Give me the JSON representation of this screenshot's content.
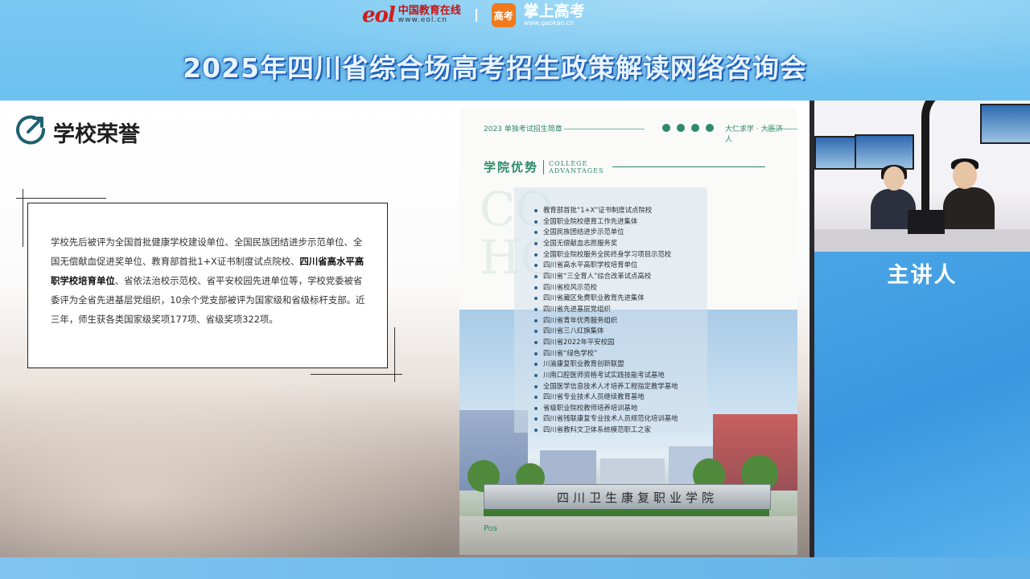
{
  "header": {
    "eol_brand": "eol",
    "eol_name": "中国教育在线",
    "eol_url": "www.eol.cn",
    "gaokao_badge": "高考",
    "gaokao_name": "掌上高考",
    "gaokao_url": "www.gaokao.cn",
    "title": "2025年四川省综合场高考招生政策解读网络咨询会"
  },
  "slide": {
    "section_title": "学校荣誉",
    "section_icon": "arrow-up-right-circle-icon",
    "paragraph": {
      "part1": "学校先后被评为全国首批健康学校建设单位、全国民族团结进步示范单位、全国无偿献血促进奖单位、教育部首批1+X证书制度试点院校、",
      "bold": "四川省高水平高职学校培育单位",
      "part2": "、省依法治校示范校、省平安校园先进单位等，学校党委被省委评为全省先进基层党组织，10余个党支部被评为国家级和省级标杆支部。近三年，师生获各类国家级奖项177项、省级奖项322项。"
    }
  },
  "brochure": {
    "year_label": "2023 单独考试招生简章",
    "motto": "大仁求学 · 大医济人",
    "section_cn": "学院优势",
    "section_en_1": "COLLEGE",
    "section_en_2": "ADVANTAGES",
    "watermark_1": "CO",
    "watermark_2": "HO",
    "gate_sign": "四川卫生康复职业学院",
    "footer_mark": "Pos",
    "honors": [
      "教育部首批“1+X”证书制度试点院校",
      "全国职业院校德育工作先进集体",
      "全国民族团结进步示范单位",
      "全国无偿献血志愿服务奖",
      "全国职业院校服务全民终身学习项目示范校",
      "四川省高水平高职学校培育单位",
      "四川省“三全育人”综合改革试点高校",
      "四川省校风示范校",
      "四川省藏区免费职业教育先进集体",
      "四川省先进基层党组织",
      "四川省青年优秀服务组织",
      "四川省三八红旗集体",
      "四川省2022年平安校园",
      "四川省“绿色学校”",
      "川渝康复职业教育创新联盟",
      "川南口腔医师资格考试实践技能考试基地",
      "全国医学信息技术人才培养工程指定教学基地",
      "四川省专业技术人员继续教育基地",
      "省级职业院校教师培养培训基地",
      "四川省残联康复专业技术人员规范化培训基地",
      "四川省教科文卫体系统模范职工之家"
    ]
  },
  "camera": {
    "label": "主讲人"
  },
  "colors": {
    "background_blue": "#5ab4ea",
    "brochure_green": "#2e8a66",
    "title_outline": "#1c5fb7"
  }
}
